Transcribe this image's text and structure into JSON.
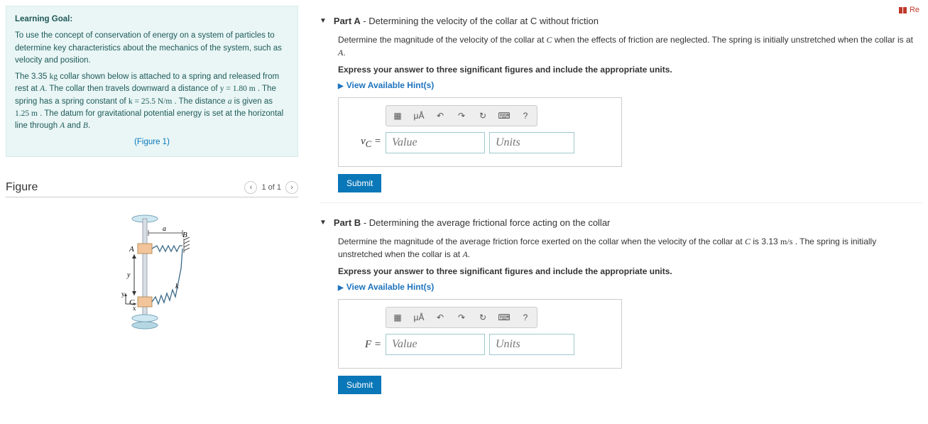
{
  "top_right": "Re",
  "learning": {
    "title": "Learning Goal:",
    "p1": "To use the concept of conservation of energy on a system of particles to determine key characteristics about the mechanics of the system, such as velocity and position.",
    "p2a": "The 3.35 ",
    "p2b": "kg",
    "p2c": " collar shown below is attached to a spring and released from rest at ",
    "p2d": "A",
    "p2e": ". The collar then travels downward a distance of ",
    "p2f": "y = 1.80 m",
    "p2g": " . The spring has a spring constant of ",
    "p2h": "k = 25.5 N/m",
    "p2i": " . The distance ",
    "p2j": "a",
    "p2k": " is given as ",
    "p2l": "1.25 m",
    "p2m": " . The datum for gravitational potential energy is set at the horizontal line through ",
    "p2n": "A",
    "p2o": " and ",
    "p2p": "B",
    "p2q": ".",
    "fig_link": "(Figure 1)"
  },
  "figure": {
    "heading": "Figure",
    "pager": "1 of 1"
  },
  "common": {
    "hints": "View Available Hint(s)",
    "submit": "Submit",
    "value_ph": "Value",
    "units_ph": "Units",
    "tool_xy": "x□",
    "tool_mu": "μÅ",
    "tool_undo": "↶",
    "tool_redo": "↷",
    "tool_reset": "↻",
    "tool_kb": "⌨",
    "tool_help": "?"
  },
  "partA": {
    "label": "Part A",
    "title": " - Determining the velocity of the collar at C without friction",
    "desc1a": "Determine the magnitude of the velocity of the collar at ",
    "desc1b": "C",
    "desc1c": " when the effects of friction are neglected. The spring is initially unstretched when the collar is at ",
    "desc1d": "A",
    "desc1e": ".",
    "desc2": "Express your answer to three significant figures and include the appropriate units.",
    "eq_label": "v_C ="
  },
  "partB": {
    "label": "Part B",
    "title": " - Determining the average frictional force acting on the collar",
    "desc1a": "Determine the magnitude of the average friction force exerted on the collar when the velocity of the collar at ",
    "desc1b": "C",
    "desc1c": " is 3.13 ",
    "desc1d": "m/s",
    "desc1e": " . The spring is initially unstretched when the collar is at ",
    "desc1f": "A",
    "desc1g": ".",
    "desc2": "Express your answer to three significant figures and include the appropriate units.",
    "eq_label": "F ="
  }
}
